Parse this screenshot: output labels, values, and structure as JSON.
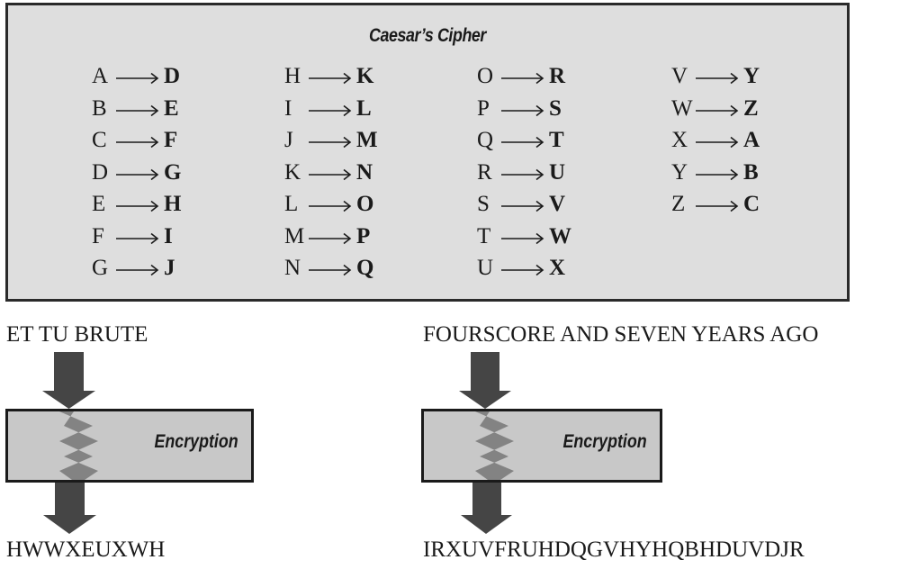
{
  "cipher_table": {
    "title": "Caesar’s Cipher",
    "columns": [
      [
        {
          "plain": "A",
          "cipher": "D"
        },
        {
          "plain": "B",
          "cipher": "E"
        },
        {
          "plain": "C",
          "cipher": "F"
        },
        {
          "plain": "D",
          "cipher": "G"
        },
        {
          "plain": "E",
          "cipher": "H"
        },
        {
          "plain": "F",
          "cipher": "I"
        },
        {
          "plain": "G",
          "cipher": "J"
        }
      ],
      [
        {
          "plain": "H",
          "cipher": "K"
        },
        {
          "plain": "I",
          "cipher": "L"
        },
        {
          "plain": "J",
          "cipher": "M"
        },
        {
          "plain": "K",
          "cipher": "N"
        },
        {
          "plain": "L",
          "cipher": "O"
        },
        {
          "plain": "M",
          "cipher": "P"
        },
        {
          "plain": "N",
          "cipher": "Q"
        }
      ],
      [
        {
          "plain": "O",
          "cipher": "R"
        },
        {
          "plain": "P",
          "cipher": "S"
        },
        {
          "plain": "Q",
          "cipher": "T"
        },
        {
          "plain": "R",
          "cipher": "U"
        },
        {
          "plain": "S",
          "cipher": "V"
        },
        {
          "plain": "T",
          "cipher": "W"
        },
        {
          "plain": "U",
          "cipher": "X"
        }
      ],
      [
        {
          "plain": "V",
          "cipher": "Y"
        },
        {
          "plain": "W",
          "cipher": "Z"
        },
        {
          "plain": "X",
          "cipher": "A"
        },
        {
          "plain": "Y",
          "cipher": "B"
        },
        {
          "plain": "Z",
          "cipher": "C"
        }
      ]
    ]
  },
  "examples": [
    {
      "plaintext": "ET TU BRUTE",
      "process_label": "Encryption",
      "ciphertext": "HWWXEUXWH"
    },
    {
      "plaintext": "FOURSCORE AND SEVEN YEARS AGO",
      "process_label": "Encryption",
      "ciphertext": "IRXUVFRUHDQGVHYHQBHDUVDJR"
    }
  ],
  "colors": {
    "table_fill": "#dedede",
    "box_fill": "#c8c8c8",
    "arrow": "#454545",
    "zigzag": "#808080",
    "border": "#1a1a1a"
  }
}
